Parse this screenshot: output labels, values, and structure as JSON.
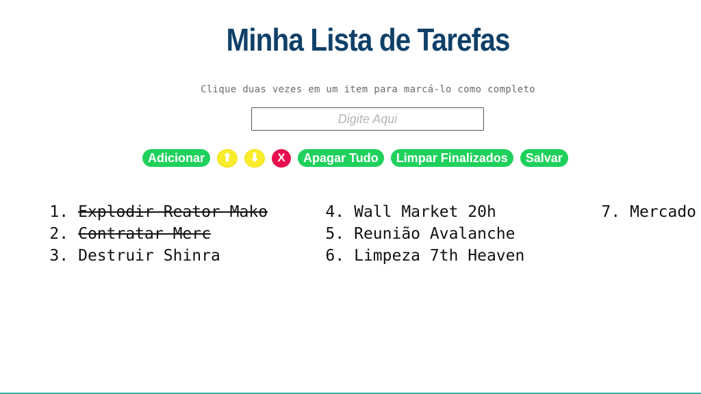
{
  "header": {
    "title": "Minha Lista de Tarefas",
    "hint": "Clique duas vezes em um item para marcá-lo como completo"
  },
  "input": {
    "placeholder": "Digite Aqui",
    "value": ""
  },
  "toolbar": {
    "add_label": "Adicionar",
    "up_label": "⬆",
    "up_icon": "arrow-up-icon",
    "down_label": "⬇",
    "down_icon": "arrow-down-icon",
    "remove_label": "X",
    "clear_all_label": "Apagar Tudo",
    "clear_done_label": "Limpar Finalizados",
    "save_label": "Salvar"
  },
  "colors": {
    "title": "#0f4068",
    "green_button": "#1fd15c",
    "yellow_button": "#f8ec2b",
    "red_button": "#e80e4d"
  },
  "tasks": [
    {
      "num": "1.",
      "text": "Explodir Reator Mako",
      "done": true
    },
    {
      "num": "2.",
      "text": "Contratar Merc",
      "done": true
    },
    {
      "num": "3.",
      "text": "Destruir Shinra",
      "done": false
    },
    {
      "num": "4.",
      "text": "Wall Market 20h",
      "done": false
    },
    {
      "num": "5.",
      "text": "Reunião Avalanche",
      "done": false
    },
    {
      "num": "6.",
      "text": "Limpeza 7th Heaven",
      "done": false
    },
    {
      "num": "7.",
      "text": "Mercado",
      "done": false
    }
  ]
}
